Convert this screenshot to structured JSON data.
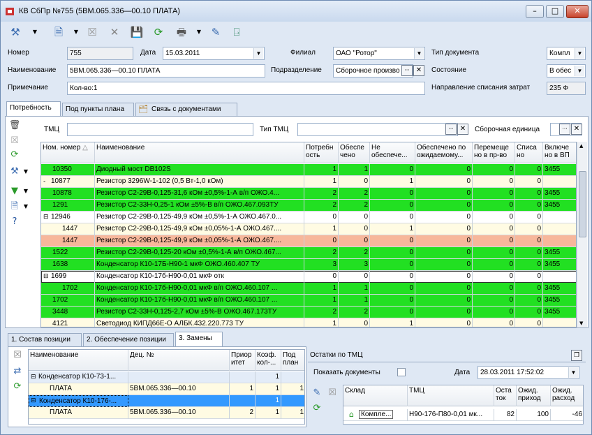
{
  "window": {
    "title": "КВ СбПр №755 (5ВМ.065.336—00.10 ПЛАТА)"
  },
  "form": {
    "nomer_label": "Номер",
    "nomer_value": "755",
    "data_label": "Дата",
    "data_value": "15.03.2011",
    "filial_label": "Филиал",
    "filial_value": "ОАО \"Ротор\"",
    "tipdoc_label": "Тип документа",
    "tipdoc_value": "Компл",
    "naim_label": "Наименование",
    "naim_value": "5ВМ.065.336—00.10 ПЛАТА",
    "podrazd_label": "Подразделение",
    "podrazd_value": "Сборочное произво",
    "sost_label": "Состояние",
    "sost_value": "В обес",
    "prim_label": "Примечание",
    "prim_value": "Кол-во:1",
    "napr_label": "Направление списания затрат",
    "napr_value": "235 Ф"
  },
  "tabs": [
    "Потребность",
    "Под пункты плана",
    "Связь с документами"
  ],
  "filters": {
    "tmc_label": "ТМЦ",
    "tiptmc_label": "Тип ТМЦ",
    "sbor_label": "Сборочная единица"
  },
  "main_grid": {
    "headers": [
      "Ном. номер",
      "Наименование",
      "Потребн ость",
      "Обеспе чено",
      "Не обеспече...",
      "Обеспечено по ожидаемому...",
      "Перемеще но в пр-во",
      "Списа но",
      "Включе но в ВП"
    ],
    "rows": [
      {
        "nom": "10350",
        "name": "Диодный мост DB102S",
        "a": "1",
        "b": "1",
        "c": "0",
        "d": "0",
        "e": "0",
        "f": "0",
        "g": "3455",
        "color": "g",
        "indent": 0,
        "tree": ""
      },
      {
        "nom": "10877",
        "name": "Резистор 3296W-1-102 (0,5 Вт-1,0 кОм)",
        "a": "1",
        "b": "0",
        "c": "1",
        "d": "0",
        "e": "0",
        "f": "0",
        "g": "",
        "color": "y",
        "indent": 0,
        "tree": "-"
      },
      {
        "nom": "10878",
        "name": "Резистор С2-29В-0,125-31,6 кОм ±0,5%-1-А в/п  ОЖО.4...",
        "a": "2",
        "b": "2",
        "c": "0",
        "d": "0",
        "e": "0",
        "f": "0",
        "g": "3455",
        "color": "g",
        "indent": 0,
        "tree": ""
      },
      {
        "nom": "1291",
        "name": "Резистор С2-33Н-0,25-1 кОм ±5%-В в/п  ОЖО.467.093ТУ",
        "a": "2",
        "b": "2",
        "c": "0",
        "d": "0",
        "e": "0",
        "f": "0",
        "g": "3455",
        "color": "g",
        "indent": 0,
        "tree": ""
      },
      {
        "nom": "12946",
        "name": "Резистор С2-29В-0,125-49,9 кОм ±0,5%-1-А  ОЖО.467.0...",
        "a": "0",
        "b": "0",
        "c": "0",
        "d": "0",
        "e": "0",
        "f": "0",
        "g": "",
        "color": "w",
        "indent": 0,
        "tree": "⊟"
      },
      {
        "nom": "1447",
        "name": "Резистор С2-29В-0,125-49,9 кОм ±0,05%-1-А  ОЖО.467....",
        "a": "1",
        "b": "0",
        "c": "1",
        "d": "0",
        "e": "0",
        "f": "0",
        "g": "",
        "color": "y",
        "indent": 1,
        "tree": ""
      },
      {
        "nom": "1447",
        "name": "Резистор С2-29В-0,125-49,9 кОм ±0,05%-1-А  ОЖО.467....",
        "a": "0",
        "b": "0",
        "c": "0",
        "d": "0",
        "e": "0",
        "f": "0",
        "g": "",
        "color": "o",
        "indent": 1,
        "tree": ""
      },
      {
        "nom": "1522",
        "name": "Резистор С2-29В-0,125-20 кОм ±0,5%-1-А в/п  ОЖО.467...",
        "a": "2",
        "b": "2",
        "c": "0",
        "d": "0",
        "e": "0",
        "f": "0",
        "g": "3455",
        "color": "g",
        "indent": 0,
        "tree": ""
      },
      {
        "nom": "1638",
        "name": "Конденсатор К10-17Б-Н90-1 мкФ  ОЖО.460.407 ТУ",
        "a": "3",
        "b": "3",
        "c": "0",
        "d": "0",
        "e": "0",
        "f": "0",
        "g": "3455",
        "color": "g",
        "indent": 0,
        "tree": ""
      },
      {
        "nom": "1699",
        "name": "Конденсатор К10-17б-Н90-0,01 мкФ отк",
        "a": "0",
        "b": "0",
        "c": "0",
        "d": "0",
        "e": "0",
        "f": "0",
        "g": "",
        "color": "w",
        "indent": 0,
        "tree": "⊟"
      },
      {
        "nom": "1702",
        "name": "Конденсатор К10-17б-Н90-0,01 мкФ в/п  ОЖО.460.107 ...",
        "a": "1",
        "b": "1",
        "c": "0",
        "d": "0",
        "e": "0",
        "f": "0",
        "g": "3455",
        "color": "g",
        "indent": 1,
        "tree": ""
      },
      {
        "nom": "1702",
        "name": "Конденсатор К10-17б-Н90-0,01 мкФ в/п  ОЖО.460.107 ...",
        "a": "1",
        "b": "1",
        "c": "0",
        "d": "0",
        "e": "0",
        "f": "0",
        "g": "3455",
        "color": "g",
        "indent": 0,
        "tree": ""
      },
      {
        "nom": "3448",
        "name": "Резистор С2-33Н-0,125-2,7 кОм ±5%-В  ОЖО.467.173ТУ",
        "a": "2",
        "b": "2",
        "c": "0",
        "d": "0",
        "e": "0",
        "f": "0",
        "g": "3455",
        "color": "g",
        "indent": 0,
        "tree": ""
      },
      {
        "nom": "4121",
        "name": "Светодиод КИПД66Е-О  АЛБК.432.220.773 ТУ",
        "a": "1",
        "b": "0",
        "c": "1",
        "d": "0",
        "e": "0",
        "f": "0",
        "g": "",
        "color": "y",
        "indent": 0,
        "tree": ""
      }
    ]
  },
  "bottom_tabs": [
    "1. Состав позиции",
    "2. Обеспечение позиции",
    "3. Замены"
  ],
  "zameny": {
    "headers": [
      "Наименование",
      "Дец. №",
      "Приор итет",
      "Коэф. кол-...",
      "Под план"
    ],
    "rows": [
      {
        "name": "Конденсатор К10-73-1...",
        "dec": "",
        "p": "",
        "k": "1",
        "pp": "",
        "tree": "⊟",
        "level": 0
      },
      {
        "name": "ПЛАТА",
        "dec": "5ВМ.065.336—00.10",
        "p": "1",
        "k": "1",
        "pp": "1",
        "tree": "",
        "level": 1
      },
      {
        "name": "Конденсатор К10-176-...",
        "dec": "",
        "p": "",
        "k": "1",
        "pp": "",
        "tree": "⊟",
        "level": 0
      },
      {
        "name": "ПЛАТА",
        "dec": "5ВМ.065.336—00.10",
        "p": "2",
        "k": "1",
        "pp": "1",
        "tree": "",
        "level": 1
      }
    ]
  },
  "ostatki": {
    "title": "Остатки по ТМЦ",
    "show_docs_label": "Показать документы",
    "date_label": "Дата",
    "date_value": "28.03.2011 17:52:02",
    "headers": [
      "Склад",
      "ТМЦ",
      "Оста ток",
      "Ожид. приход",
      "Ожид. расход"
    ],
    "row": {
      "sklad": "Компле...",
      "tmc": "Н90-176-П80-0,01 мк...",
      "ost": "82",
      "prih": "100",
      "rash": "-46"
    }
  }
}
